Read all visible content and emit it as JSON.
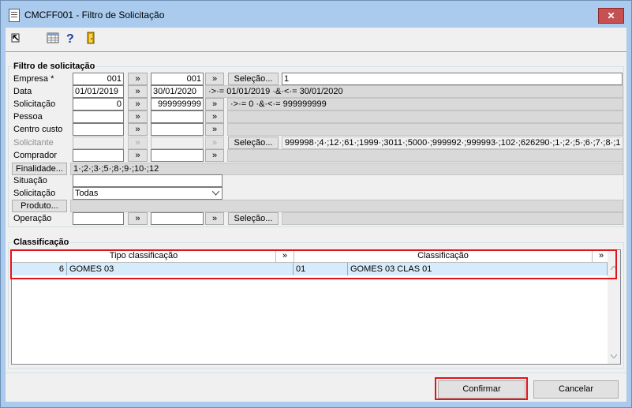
{
  "window": {
    "title": "CMCFF001 - Filtro de Solicitação",
    "close_symbol": "✕"
  },
  "toolbar": {
    "icons": [
      "arrow-cursor-icon",
      "table-icon",
      "help-icon",
      "exit-door-icon"
    ],
    "help_symbol": "?"
  },
  "filtro": {
    "legend": "Filtro de solicitação",
    "arrow_symbol": "»",
    "empresa": {
      "label": "Empresa *",
      "from": "001",
      "to": "001",
      "button": "Seleção...",
      "result": "1"
    },
    "data": {
      "label": "Data",
      "from": "01/01/2019",
      "to": "30/01/2020",
      "result": "·>·= 01/01/2019 ·&·<·= 30/01/2020"
    },
    "solicitacao": {
      "label": "Solicitação",
      "from": "0",
      "to": "999999999",
      "result": "·>·= 0 ·&·<·= 999999999"
    },
    "pessoa": {
      "label": "Pessoa",
      "from": "",
      "to": "",
      "result": ""
    },
    "centro_custo": {
      "label": "Centro custo",
      "from": "",
      "to": "",
      "result": ""
    },
    "solicitante": {
      "label": "Solicitante",
      "from": "",
      "to": "",
      "button": "Seleção...",
      "result": "999998·;4·;12·;61·;1999·;3011·;5000·;999992·;999993·;102·;626290·;1·;2·;5·;6·;7·;8·;1"
    },
    "comprador": {
      "label": "Comprador",
      "from": "",
      "to": "",
      "result": ""
    },
    "finalidade": {
      "button": "Finalidade...",
      "result": "1·;2·;3·;5·;8·;9·;10·;12"
    },
    "situacao": {
      "label": "Situação",
      "value": ""
    },
    "solicitacao_status": {
      "label": "Solicitação",
      "value": "Todas"
    },
    "produto": {
      "button": "Produto...",
      "result": ""
    },
    "operacao": {
      "label": "Operação",
      "from": "",
      "to": "",
      "button": "Seleção...",
      "result": ""
    }
  },
  "classificacao": {
    "legend": "Classificação",
    "columns": [
      "Tipo classificação",
      "Classificação"
    ],
    "arrow_symbol": "»",
    "rows": [
      {
        "id": "6",
        "tipo": "GOMES 03",
        "code": "01",
        "classificacao": "GOMES 03 CLAS 01"
      }
    ]
  },
  "footer": {
    "confirm": "Confirmar",
    "cancel": "Cancelar"
  }
}
